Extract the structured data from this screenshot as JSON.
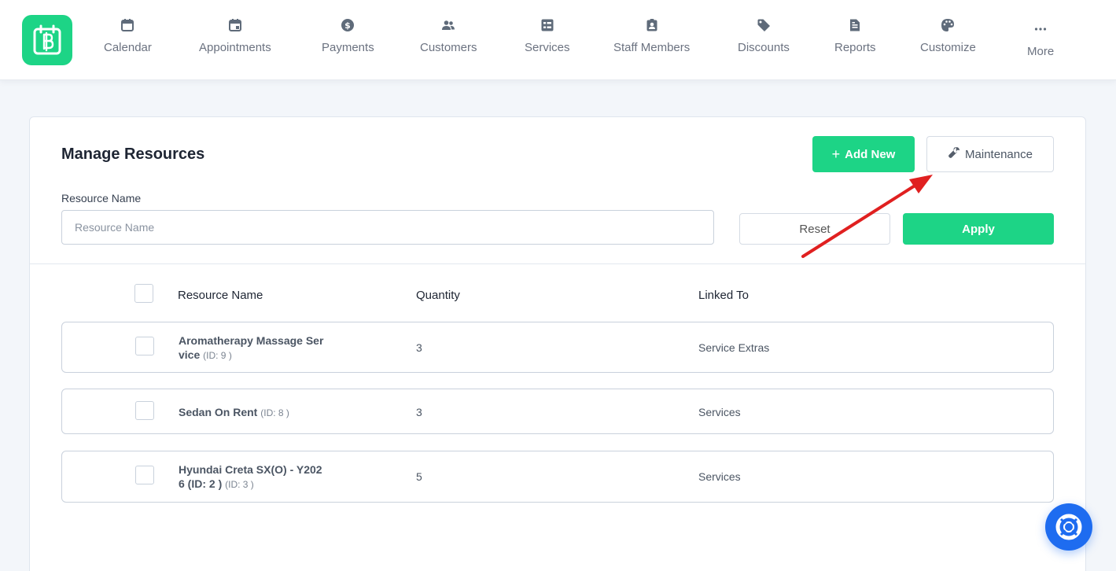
{
  "nav": {
    "items": [
      {
        "label": "Calendar",
        "icon": "calendar-icon"
      },
      {
        "label": "Appointments",
        "icon": "calendar-check-icon"
      },
      {
        "label": "Payments",
        "icon": "dollar-circle-icon"
      },
      {
        "label": "Customers",
        "icon": "users-icon"
      },
      {
        "label": "Services",
        "icon": "list-icon"
      },
      {
        "label": "Staff Members",
        "icon": "badge-icon"
      },
      {
        "label": "Discounts",
        "icon": "tag-icon"
      },
      {
        "label": "Reports",
        "icon": "report-icon"
      },
      {
        "label": "Customize",
        "icon": "palette-icon"
      },
      {
        "label": "More",
        "icon": "more-icon"
      }
    ]
  },
  "page": {
    "title": "Manage Resources",
    "add_new_label": "Add New",
    "maintenance_label": "Maintenance",
    "filter_label": "Resource Name",
    "filter_placeholder": "Resource Name",
    "reset_label": "Reset",
    "apply_label": "Apply"
  },
  "table": {
    "headers": {
      "name": "Resource Name",
      "quantity": "Quantity",
      "linked": "Linked To"
    },
    "rows": [
      {
        "name_line1": "Aromatherapy Massage Ser",
        "name_line2": "vice",
        "id": "(ID: 9 )",
        "quantity": "3",
        "linked": "Service Extras"
      },
      {
        "name_line1": "Sedan On Rent",
        "name_line2": "",
        "id": "(ID: 8 )",
        "quantity": "3",
        "linked": "Services"
      },
      {
        "name_line1": "Hyundai Creta SX(O) - Y202",
        "name_line2": "6 (ID: 2 )",
        "id": "(ID: 3 )",
        "quantity": "5",
        "linked": "Services"
      }
    ]
  },
  "colors": {
    "accent": "#1dd486",
    "help": "#1e6cf0",
    "arrow": "#e02020"
  }
}
